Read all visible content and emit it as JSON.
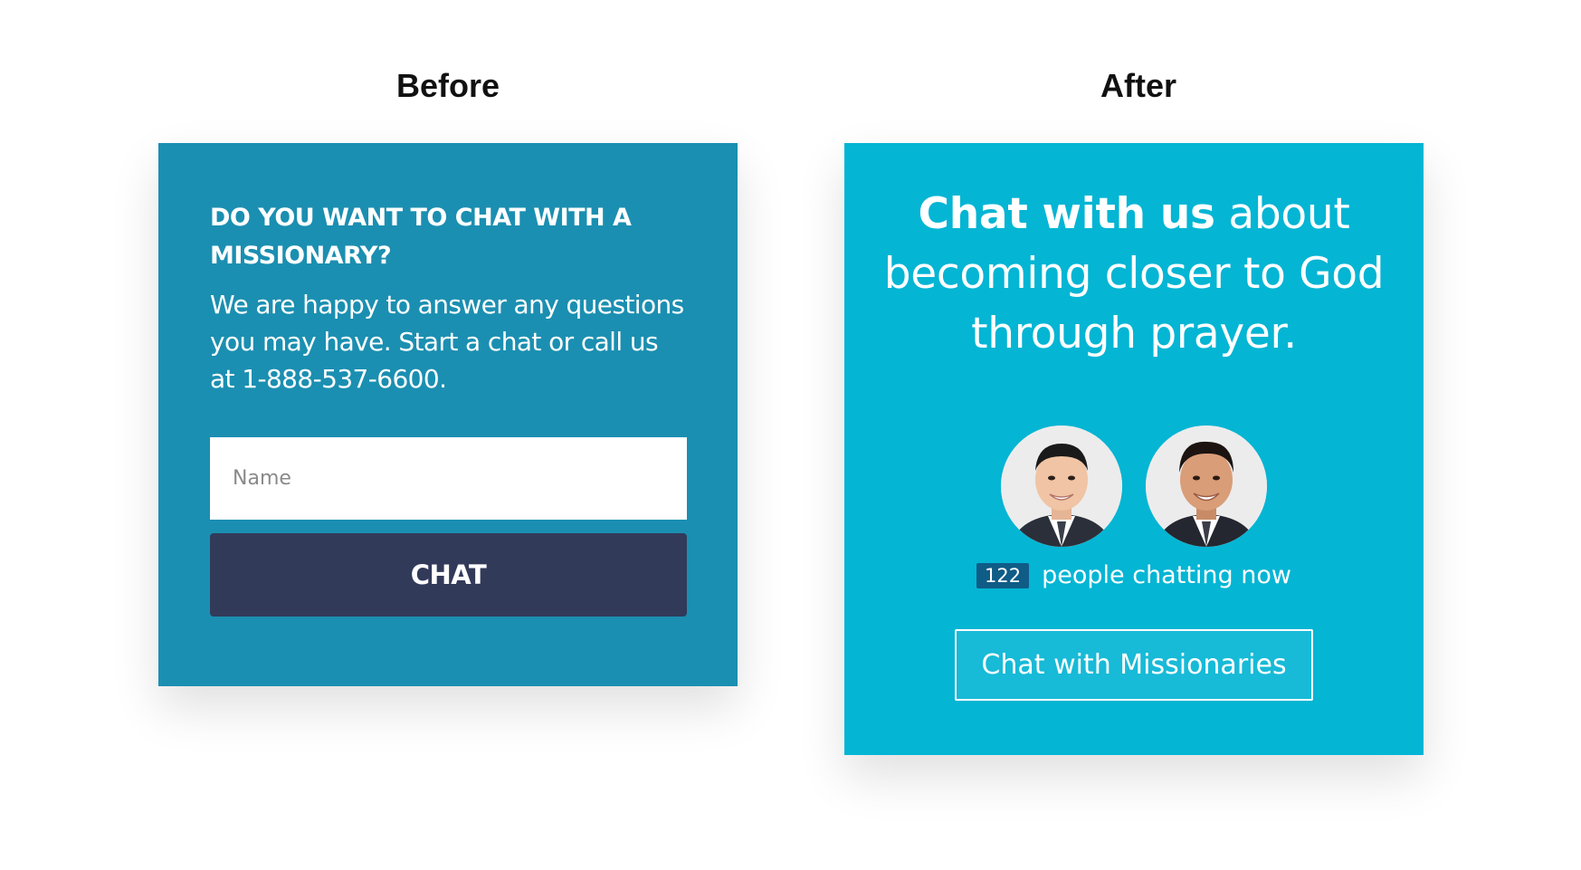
{
  "labels": {
    "before": "Before",
    "after": "After"
  },
  "before_card": {
    "heading": "DO YOU WANT TO CHAT WITH A MISSIONARY?",
    "body": "We are happy to answer any questions you may have. Start a chat or call us at 1-888-537-6600.",
    "name_placeholder": "Name",
    "chat_button": "CHAT",
    "colors": {
      "background": "#1b8fb1",
      "button": "#323a5a"
    }
  },
  "after_card": {
    "heading_strong": "Chat with us",
    "heading_rest": " about becoming closer to God through prayer.",
    "avatars": [
      "missionary-avatar-1",
      "missionary-avatar-2"
    ],
    "count": "122",
    "status_text": "people chatting now",
    "button": "Chat with Missionaries",
    "colors": {
      "background": "#04b5d4",
      "badge": "#0f5c87"
    }
  }
}
